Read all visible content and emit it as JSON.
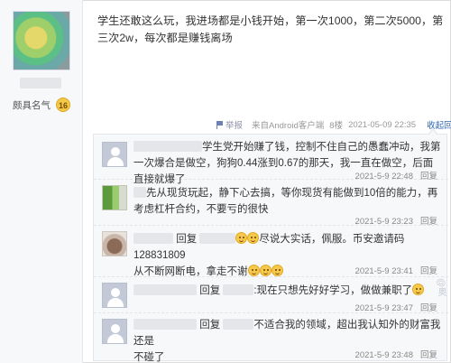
{
  "author": {
    "rank_label": "颇具名气",
    "level": "16"
  },
  "post": {
    "content": "学生还敢这么玩，我进场都是小钱开始，第一次1000，第二次5000，第三次2w，每次都是赚钱离场",
    "report_label": "举报",
    "client": "来自Android客户端",
    "floor": "8楼",
    "time": "2021-05-09 22:35",
    "collapse_label": "收起回复"
  },
  "replies": [
    {
      "text": "学生党开始赚了钱，控制不住自己的愚蠢冲动，我第一次爆合是做空，狗狗0.44涨到0.67的那天，我一直在做空，后面直接就爆了",
      "time": "2021-5-9 22:48",
      "reply_label": "回复"
    },
    {
      "text": "先从现货玩起，静下心去搞，等你现货有能做到10倍的能力，再考虑杠杆合约，不要亏的很快",
      "time": "2021-5-9 23:23",
      "reply_label": "回复"
    },
    {
      "prefix": "回复",
      "text_a": "尽说大实话，佩服。币安邀请码128831809",
      "text_b": "从不断网断电，拿走不谢",
      "time": "2021-5-9 23:41",
      "reply_label": "回复"
    },
    {
      "prefix": "回复",
      "text": ":现在只想先好好学习，做做兼职了",
      "time": "2021-5-9 23:47",
      "reply_label": "回复"
    },
    {
      "prefix": "回复",
      "text_a": "不适合我的领域，超出我认知外的财富我还是",
      "text_b": "不碰了",
      "time": "2021-5-9 23:48",
      "reply_label": "回复"
    }
  ],
  "watermark": "@奥"
}
